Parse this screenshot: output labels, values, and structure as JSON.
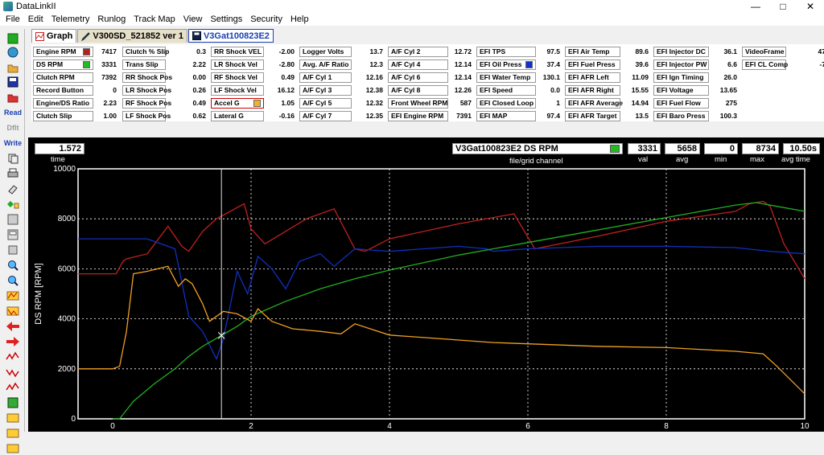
{
  "window": {
    "title": "DataLinkII",
    "min": "—",
    "max": "□",
    "close": "✕"
  },
  "menu": [
    "File",
    "Edit",
    "Telemetry",
    "Runlog",
    "Track Map",
    "View",
    "Settings",
    "Security",
    "Help"
  ],
  "toolbar": {
    "read_label": "Read",
    "write_label": "Write",
    "dflt_label": "Dflt"
  },
  "tabs": [
    {
      "label": "Graph"
    },
    {
      "label": "V300SD_521852 ver 1"
    },
    {
      "label": "V3Gat100823E2"
    }
  ],
  "channels": [
    [
      {
        "label": "Engine RPM",
        "value": "7417",
        "swatch": "#b22222"
      },
      {
        "label": "DS RPM",
        "value": "3331",
        "swatch": "#22bb22"
      },
      {
        "label": "Clutch RPM",
        "value": "7392"
      },
      {
        "label": "Record Button",
        "value": "0"
      },
      {
        "label": "Engine/DS Ratio",
        "value": "2.23"
      },
      {
        "label": "Clutch Slip",
        "value": "1.00"
      }
    ],
    [
      {
        "label": "Clutch % Slip",
        "value": "0.3"
      },
      {
        "label": "Trans Slip",
        "value": "2.22"
      },
      {
        "label": "RR Shock Pos",
        "value": "0.00"
      },
      {
        "label": "LR Shock Pos",
        "value": "0.26"
      },
      {
        "label": "RF Shock Pos",
        "value": "0.49"
      },
      {
        "label": "LF Shock Pos",
        "value": "0.62"
      }
    ],
    [
      {
        "label": "RR Shock VEL",
        "value": "-2.00"
      },
      {
        "label": "LR Shock Vel",
        "value": "-2.80"
      },
      {
        "label": "RF Shock Vel",
        "value": "0.49"
      },
      {
        "label": "LF Shock Vel",
        "value": "16.12"
      },
      {
        "label": "Accel G",
        "value": "1.05",
        "swatch": "#f0b030",
        "highlight": true
      },
      {
        "label": "Lateral G",
        "value": "-0.16"
      }
    ],
    [
      {
        "label": "Logger Volts",
        "value": "13.7"
      },
      {
        "label": "Avg. A/F Ratio",
        "value": "12.3"
      },
      {
        "label": "A/F Cyl 1",
        "value": "12.16"
      },
      {
        "label": "A/F Cyl 3",
        "value": "12.38"
      },
      {
        "label": "A/F Cyl 5",
        "value": "12.32"
      },
      {
        "label": "A/F Cyl 7",
        "value": "12.35"
      }
    ],
    [
      {
        "label": "A/F Cyl 2",
        "value": "12.72"
      },
      {
        "label": "A/F Cyl 4",
        "value": "12.14"
      },
      {
        "label": "A/F Cyl 6",
        "value": "12.14"
      },
      {
        "label": "A/F Cyl 8",
        "value": "12.26"
      },
      {
        "label": "Front Wheel RPM",
        "value": "587"
      },
      {
        "label": "EFI Engine RPM",
        "value": "7391"
      }
    ],
    [
      {
        "label": "EFI TPS",
        "value": "97.5"
      },
      {
        "label": "EFI Oil Press",
        "value": "37.4",
        "swatch": "#1030d0"
      },
      {
        "label": "EFI Water Temp",
        "value": "130.1"
      },
      {
        "label": "EFI Speed",
        "value": "0.0"
      },
      {
        "label": "EFI Closed Loop",
        "value": "1"
      },
      {
        "label": "EFI MAP",
        "value": "97.4"
      }
    ],
    [
      {
        "label": "EFI Air Temp",
        "value": "89.6"
      },
      {
        "label": "EFI Fuel Press",
        "value": "39.6"
      },
      {
        "label": "EFI AFR Left",
        "value": "11.09"
      },
      {
        "label": "EFI AFR Right",
        "value": "15.55"
      },
      {
        "label": "EFI AFR Average",
        "value": "14.94"
      },
      {
        "label": "EFI AFR Target",
        "value": "13.5"
      }
    ],
    [
      {
        "label": "EFI Injector DC",
        "value": "36.1"
      },
      {
        "label": "EFI Injector PW",
        "value": "6.6"
      },
      {
        "label": "EFI Ign Timing",
        "value": "26.0"
      },
      {
        "label": "EFI Voltage",
        "value": "13.65"
      },
      {
        "label": "EFI Fuel Flow",
        "value": "275"
      },
      {
        "label": "EFI Baro Press",
        "value": "100.3"
      }
    ],
    [
      {
        "label": "VideoFrame",
        "value": "47"
      },
      {
        "label": "EFI CL Comp",
        "value": "-7"
      }
    ]
  ],
  "graph_header": {
    "time_value": "1.572",
    "time_label": "time",
    "channel": "V3Gat100823E2    DS RPM",
    "channel_label": "file/grid channel",
    "channel_swatch": "#22bb22",
    "val": "3331",
    "val_label": "val",
    "avg": "5658",
    "avg_label": "avg",
    "min": "0",
    "min_label": "min",
    "max": "8734",
    "max_label": "max",
    "avgtime": "10.50s",
    "avgtime_label": "avg time"
  },
  "chart_data": {
    "type": "line",
    "ylabel": "DS RPM [RPM]",
    "xlabel": "",
    "xlim": [
      -0.5,
      10
    ],
    "ylim": [
      0,
      10000
    ],
    "xticks": [
      "0",
      "2",
      "4",
      "6",
      "8",
      "10"
    ],
    "yticks": [
      "0",
      "2000",
      "4000",
      "6000",
      "8000",
      "10000"
    ],
    "cursor_x": 1.572,
    "grid": true,
    "series": [
      {
        "color": "#c02020",
        "x": [
          -0.5,
          0.05,
          0.15,
          0.2,
          0.5,
          0.8,
          1.0,
          1.1,
          1.3,
          1.5,
          1.9,
          2.0,
          2.2,
          2.8,
          3.2,
          3.5,
          3.65,
          4.0,
          5.0,
          5.8,
          6.1,
          7.0,
          8.0,
          9.0,
          9.2,
          9.4,
          9.5,
          9.7,
          10.0
        ],
        "y": [
          5800,
          5800,
          6300,
          6400,
          6600,
          7700,
          6900,
          6700,
          7500,
          8000,
          8600,
          7600,
          7000,
          8000,
          8400,
          6800,
          6700,
          7200,
          7800,
          8200,
          6800,
          7300,
          7900,
          8300,
          8600,
          8700,
          8500,
          7000,
          5600
        ]
      },
      {
        "color": "#1030c0",
        "x": [
          -0.5,
          0.0,
          0.5,
          0.9,
          1.1,
          1.3,
          1.5,
          1.6,
          1.8,
          1.95,
          2.1,
          2.3,
          2.5,
          2.7,
          3.0,
          3.2,
          3.5,
          4.0,
          5.0,
          5.4,
          5.5,
          6.0,
          7.0,
          8.0,
          9.0,
          9.5,
          10.0
        ],
        "y": [
          7200,
          7200,
          7200,
          6800,
          4100,
          3500,
          2400,
          3200,
          5900,
          5000,
          6500,
          6000,
          5200,
          6300,
          6600,
          6100,
          6800,
          6700,
          6900,
          6800,
          6700,
          6800,
          6900,
          6900,
          6850,
          6700,
          6600
        ]
      },
      {
        "color": "#20b020",
        "x": [
          0.0,
          0.1,
          0.3,
          0.6,
          0.9,
          1.1,
          1.3,
          1.57,
          1.8,
          2.0,
          2.5,
          3.0,
          3.5,
          4.0,
          4.5,
          5.0,
          5.5,
          6.0,
          7.0,
          8.0,
          9.0,
          9.3,
          9.6,
          10.0
        ],
        "y": [
          0,
          0,
          700,
          1400,
          2000,
          2500,
          2900,
          3331,
          3700,
          4100,
          4700,
          5200,
          5600,
          5950,
          6250,
          6550,
          6800,
          7050,
          7550,
          8050,
          8550,
          8650,
          8500,
          8300
        ]
      },
      {
        "color": "#f0a020",
        "x": [
          -0.5,
          0.0,
          0.1,
          0.2,
          0.3,
          0.5,
          0.8,
          0.95,
          1.05,
          1.15,
          1.3,
          1.4,
          1.6,
          1.8,
          2.0,
          2.1,
          2.3,
          2.6,
          3.0,
          3.3,
          3.5,
          4.0,
          5.0,
          5.5,
          6.0,
          7.0,
          8.0,
          9.0,
          9.4,
          9.6,
          10.0
        ],
        "y": [
          2000,
          2000,
          2100,
          3500,
          5800,
          5900,
          6100,
          5300,
          5600,
          5400,
          4600,
          3900,
          4300,
          4200,
          3900,
          4400,
          3900,
          3600,
          3500,
          3400,
          3800,
          3350,
          3150,
          3050,
          3000,
          2900,
          2850,
          2700,
          2600,
          2100,
          1000
        ]
      }
    ]
  }
}
